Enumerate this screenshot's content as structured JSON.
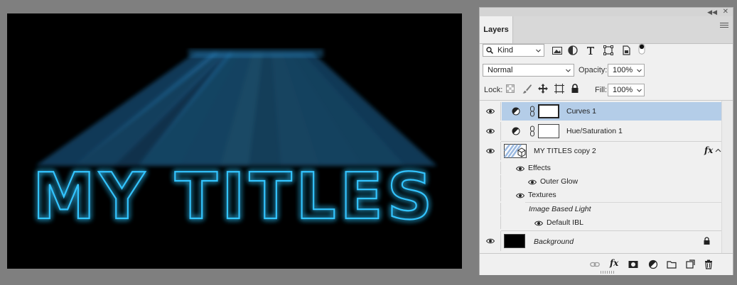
{
  "canvas": {
    "text": "MY TITLES"
  },
  "panel": {
    "tab_label": "Layers",
    "filter": {
      "kind": "Kind"
    },
    "blend_mode": "Normal",
    "opacity_label": "Opacity:",
    "opacity_value": "100%",
    "lock_label": "Lock:",
    "fill_label": "Fill:",
    "fill_value": "100%"
  },
  "layers": [
    {
      "name": "Curves 1",
      "selected": true
    },
    {
      "name": "Hue/Saturation 1"
    },
    {
      "name": "MY TITLES copy 2",
      "fx": "fx"
    },
    {
      "name": "Effects"
    },
    {
      "name": "Outer Glow"
    },
    {
      "name": "Textures"
    },
    {
      "name": "Image Based Light"
    },
    {
      "name": "Default IBL"
    },
    {
      "name": "Background"
    }
  ],
  "colors": {
    "neon": "#33c4ff",
    "selected_row": "#b4cde8",
    "panel_bg": "#f0f0f0"
  },
  "bottom_icons": [
    "link-icon",
    "fx-icon",
    "mask-icon",
    "adjustment-icon",
    "group-folder-icon",
    "new-layer-icon",
    "trash-icon"
  ]
}
